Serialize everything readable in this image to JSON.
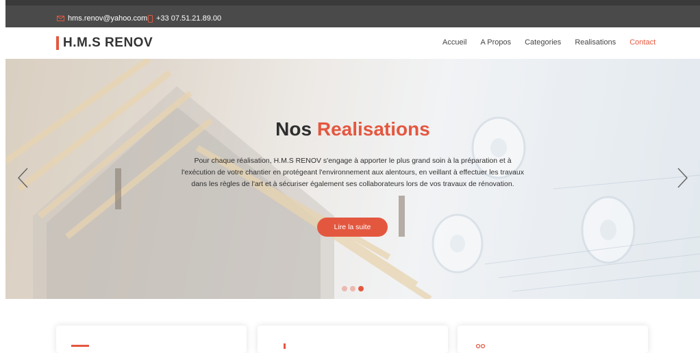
{
  "topbar": {
    "email": "hms.renov@yahoo.com",
    "phone": "+33 07.51.21.89.00"
  },
  "brand": {
    "name": "H.M.S RENOV",
    "accent_color": "#e4573f"
  },
  "nav": {
    "items": [
      "Accueil",
      "A Propos",
      "Categories",
      "Realisations",
      "Contact"
    ],
    "active": "Contact"
  },
  "hero": {
    "title_part1": "Nos",
    "title_part2": "Realisations",
    "text": "Pour chaque réalisation, H.M.S RENOV s'engage à apporter le plus grand soin à la préparation et à l'exécution de votre chantier en protégeant l'environnement aux alentours, en veillant à effectuer les travaux dans les règles de l'art et à sécuriser également ses collaborateurs lors de vos travaux de rénovation.",
    "cta": "Lire la suite",
    "slides": 3,
    "active_slide": 3
  },
  "icons": {
    "email": "envelope-icon",
    "phone": "phone-icon",
    "prev": "chevron-left-icon",
    "next": "chevron-right-icon"
  }
}
